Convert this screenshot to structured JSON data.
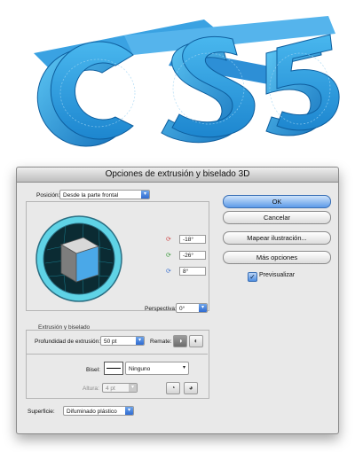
{
  "artwork": {
    "text": "CS5",
    "color": "#2e9de0"
  },
  "dialog": {
    "title": "Opciones de extrusión y biselado 3D",
    "position_label": "Posición:",
    "position_value": "Desde la parte frontal",
    "rot_x": "-18°",
    "rot_y": "-26°",
    "rot_z": "8°",
    "perspective_label": "Perspectiva:",
    "perspective_value": "0°",
    "extrude_section": "Extrusión y biselado",
    "extrude_depth_label": "Profundidad de extrusión:",
    "extrude_depth_value": "50 pt",
    "cap_label": "Remate:",
    "bevel_label": "Bisel:",
    "bevel_value": "Ninguno",
    "height_label": "Altura:",
    "height_value": "4 pt",
    "surface_label": "Superficie:",
    "surface_value": "Difuminado plástico",
    "buttons": {
      "ok": "OK",
      "cancel": "Cancelar",
      "map_art": "Mapear ilustración...",
      "more": "Más opciones"
    },
    "preview_label": "Previsualizar"
  },
  "colors": {
    "accent": "#3a7be0",
    "cube_outer": "#5fd3e6"
  }
}
